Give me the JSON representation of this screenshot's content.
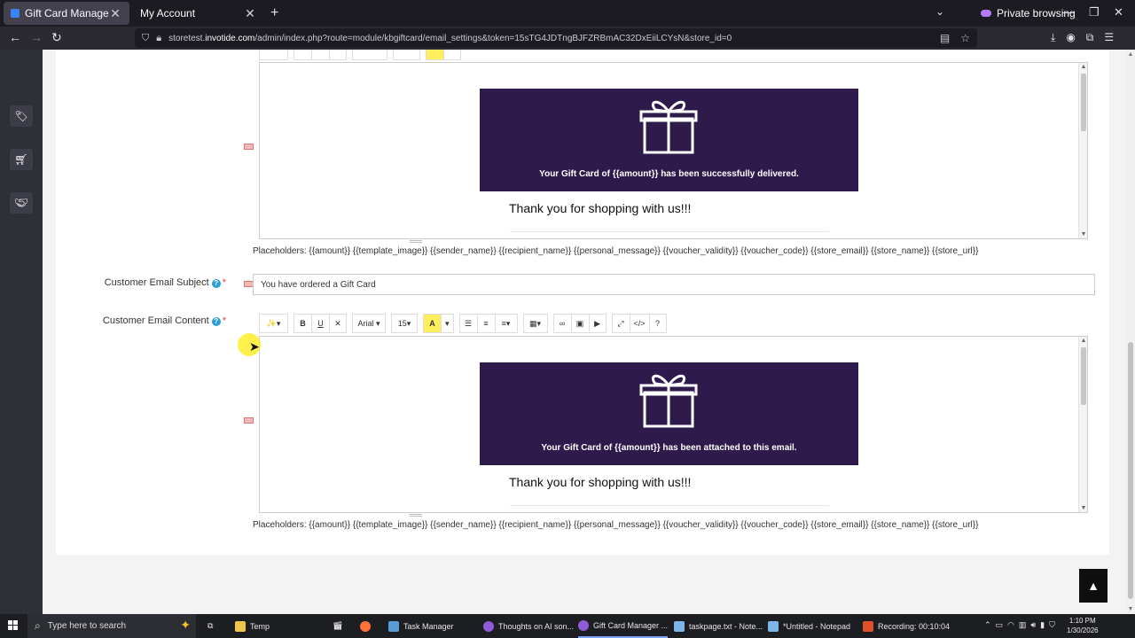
{
  "browser": {
    "tabs": [
      {
        "title": "Gift Card Manager",
        "active": true
      },
      {
        "title": "My Account",
        "active": false
      }
    ],
    "private_label": "Private browsing",
    "url_prefix": "storetest.",
    "url_domain": "invotide.com",
    "url_rest": "/admin/index.php?route=module/kbgiftcard/email_settings&token=15sTG4JDTngBJFZRBmAC32DxEiiLCYsN&store_id=0"
  },
  "sidebar": {
    "items": [
      {
        "icon": "tag-icon"
      },
      {
        "icon": "cart-icon"
      },
      {
        "icon": "handshake-icon"
      }
    ]
  },
  "sender_section": {
    "banner_text": "Your Gift Card of {{amount}} has been successfully delivered.",
    "thanks_text": "Thank you for shopping with us!!!",
    "placeholders": "Placeholders: {{amount}} {{template_image}} {{sender_name}} {{recipient_name}} {{personal_message}} {{voucher_validity}} {{voucher_code}} {{store_email}} {{store_name}} {{store_url}}"
  },
  "customer_subject": {
    "label": "Customer Email Subject",
    "help": "?",
    "required": "*",
    "value": "You have ordered a Gift Card"
  },
  "customer_content": {
    "label": "Customer Email Content",
    "help": "?",
    "required": "*",
    "toolbar": {
      "magic": "✨▾",
      "bold": "B",
      "underline": "U",
      "eraser": "✕",
      "font": "Arial ▾",
      "size": "15▾",
      "color": "A",
      "color_drop": "▾",
      "ul": "☰",
      "ol": "≡",
      "align": "≡▾",
      "table": "▦▾",
      "link": "∞",
      "image": "▣",
      "video": "▶",
      "fullscreen": "⤢",
      "code": "</>",
      "help": "?"
    },
    "banner_text": "Your Gift Card of {{amount}} has been attached to this email.",
    "thanks_text": "Thank you for shopping with us!!!",
    "placeholders": "Placeholders: {{amount}} {{template_image}} {{sender_name}} {{recipient_name}} {{personal_message}} {{voucher_validity}} {{voucher_code}} {{store_email}} {{store_name}} {{store_url}}"
  },
  "taskbar": {
    "search_placeholder": "Type here to search",
    "tasks": [
      {
        "label": "Temp"
      },
      {
        "label": "Task Manager"
      },
      {
        "label": "Thoughts on AI son..."
      },
      {
        "label": "Gift Card Manager ..."
      },
      {
        "label": "taskpage.txt - Note..."
      },
      {
        "label": "*Untitled - Notepad"
      },
      {
        "label": "Recording:  00:10:04"
      }
    ],
    "time": "1:10 PM",
    "date": "1/30/2026"
  }
}
